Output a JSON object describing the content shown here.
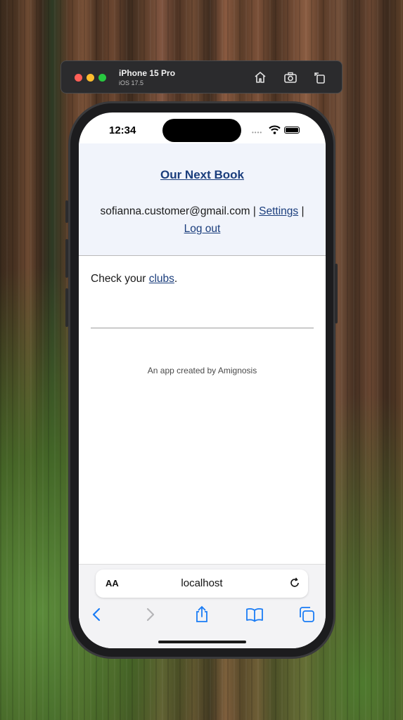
{
  "simulator": {
    "device_name": "iPhone 15 Pro",
    "os_version": "iOS 17.5"
  },
  "status_bar": {
    "time": "12:34"
  },
  "page": {
    "title": "Our Next Book",
    "user_email": "sofianna.customer@gmail.com",
    "separator": "|",
    "settings_link": "Settings",
    "logout_link": "Log out",
    "check_prefix": "Check your",
    "clubs_link": "clubs",
    "check_suffix": ".",
    "footer_credit": "An app created by Amignosis"
  },
  "browser": {
    "text_size_label": "AA",
    "url": "localhost"
  },
  "colors": {
    "link": "#1a3d7c",
    "header_bg": "#f1f4fb",
    "ios_blue": "#1a7cf5"
  }
}
